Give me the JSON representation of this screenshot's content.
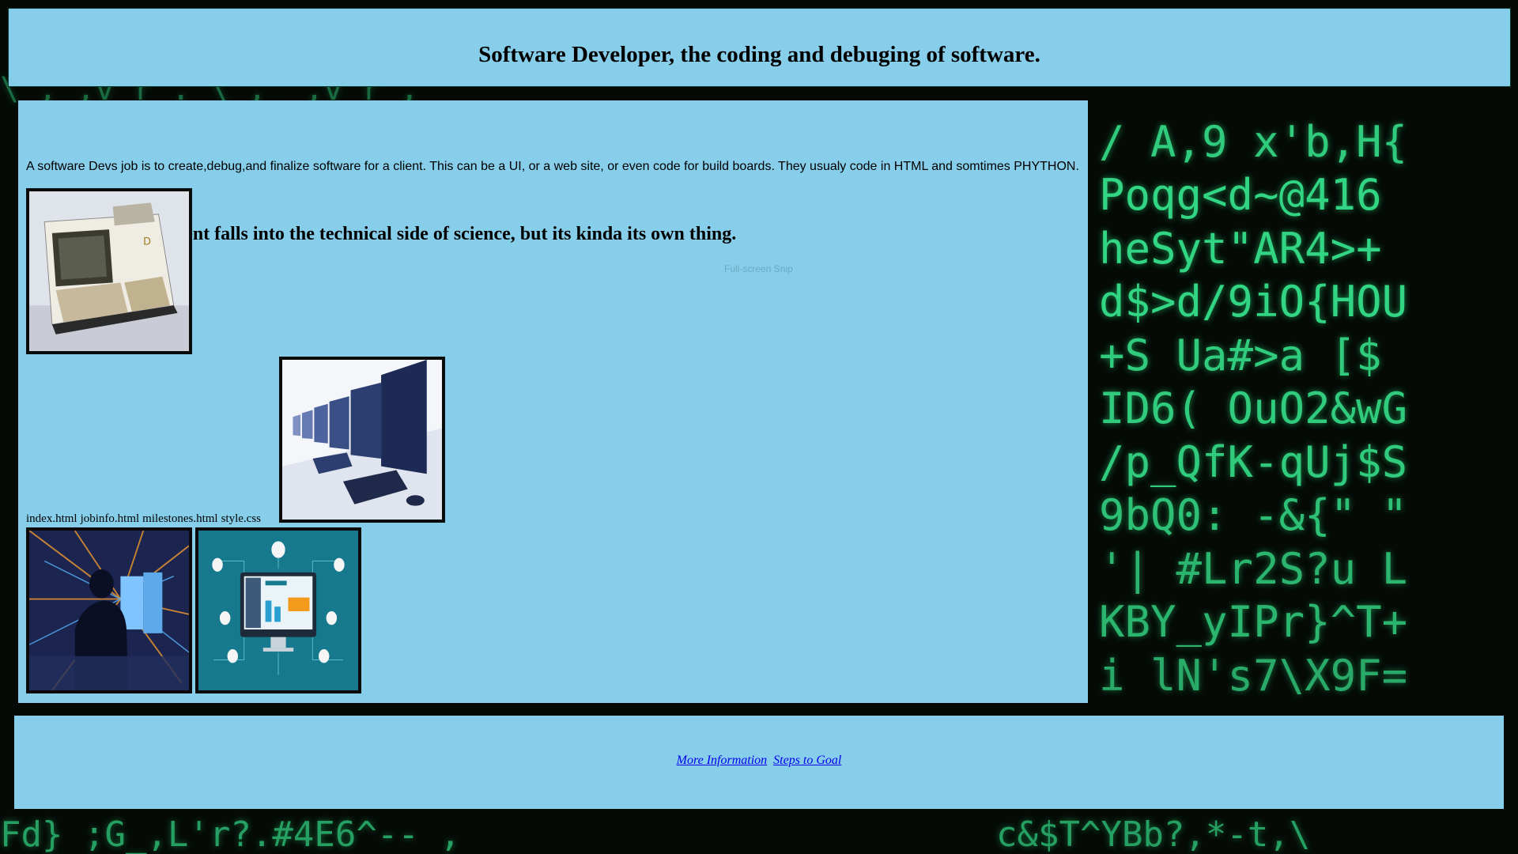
{
  "header": {
    "title": "Software Developer, the coding and debuging of software."
  },
  "main": {
    "heading": "Software Development falls into the technical side of science, but its kinda its own thing.",
    "description": "A software Devs job is to create,debug,and finalize software for a client. This can be a UI, or a web site, or even code for build boards. They usualy code in HTML and somtimes PHYTHON.",
    "ghost_text": "Full-screen Snip",
    "files": [
      "index.html",
      "jobinfo.html",
      "milestones.html",
      "style.css"
    ]
  },
  "footer": {
    "links": [
      {
        "label": "More Information"
      },
      {
        "label": "Steps to Goal"
      }
    ]
  },
  "background": {
    "rows": [
      "\\ ,_,v r . \\ ,_ ,v r ,",
      "/  A,9  x'b,H{",
      "Poqg<d~@416",
      "heSyt\"AR4>+",
      "d$>d/9iO{HOU",
      " +S  Ua#>a  [$",
      "ID6(  OuO2&wG",
      "/p_QfK-qUj$S",
      "9bQ0:  -&{\" \"",
      "'|  #Lr2S?u  L",
      "KBY_yIPr}^T+",
      "i  lN's7\\X9F=",
      "Fd} ;G_,L'r?.#4E6^-- ,",
      "c&$T^YBb?,*-t,\\"
    ],
    "accent_color": "#35e08a"
  }
}
